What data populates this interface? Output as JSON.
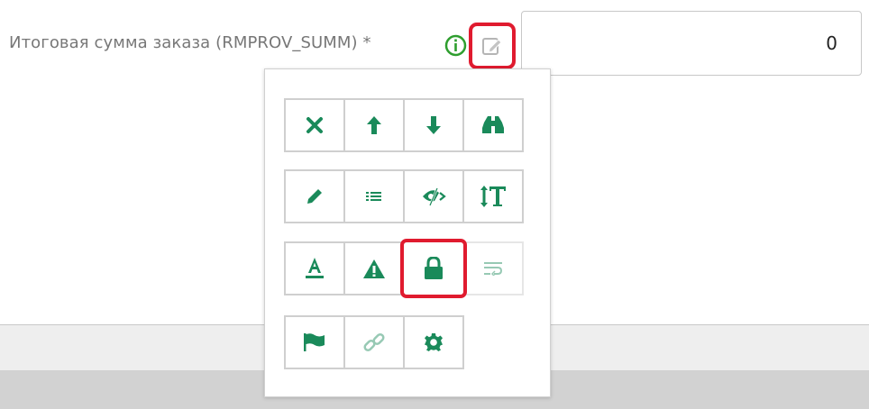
{
  "field": {
    "label": "Итоговая сумма заказа (RMPROV_SUMM) *",
    "value": "0"
  },
  "colors": {
    "accent_green": "#1a8a5a",
    "highlight_red": "#e01b2f",
    "info_green": "#2e9e2e"
  },
  "toolbar": {
    "rows": [
      [
        {
          "icon": "close-icon",
          "enabled": true
        },
        {
          "icon": "arrow-up-icon",
          "enabled": true
        },
        {
          "icon": "arrow-down-icon",
          "enabled": true
        },
        {
          "icon": "binoculars-icon",
          "enabled": true
        }
      ],
      [
        {
          "icon": "pencil-icon",
          "enabled": true
        },
        {
          "icon": "list-icon",
          "enabled": true
        },
        {
          "icon": "hidden-eye-icon",
          "enabled": true
        },
        {
          "icon": "text-size-icon",
          "enabled": true
        }
      ],
      [
        {
          "icon": "font-color-icon",
          "enabled": true
        },
        {
          "icon": "warning-icon",
          "enabled": true
        },
        {
          "icon": "lock-icon",
          "enabled": true,
          "selected": true
        },
        {
          "icon": "text-wrap-icon",
          "enabled": false
        }
      ],
      [
        {
          "icon": "flag-icon",
          "enabled": true
        },
        {
          "icon": "link-icon",
          "enabled": false
        },
        {
          "icon": "gear-icon",
          "enabled": true
        }
      ]
    ]
  }
}
